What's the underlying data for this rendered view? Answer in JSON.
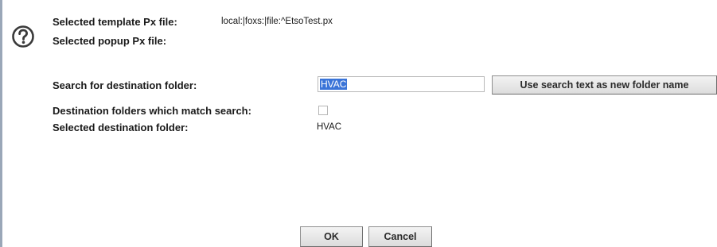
{
  "icons": {
    "help": "question-mark-circle-icon"
  },
  "template": {
    "label": "Selected template Px file:",
    "value": "local:|foxs:|file:^EtsoTest.px"
  },
  "popup": {
    "label": "Selected popup Px file:"
  },
  "search": {
    "label": "Search for destination folder:",
    "value": "HVAC",
    "button_label": "Use search text as new folder name"
  },
  "matches": {
    "label": "Destination folders which match search:",
    "checked": false
  },
  "destination": {
    "label": "Selected destination folder:",
    "value": "HVAC"
  },
  "buttons": {
    "ok": "OK",
    "cancel": "Cancel"
  },
  "colors": {
    "selection": "#3a74d8",
    "button_bg": "#dcdcdc"
  }
}
